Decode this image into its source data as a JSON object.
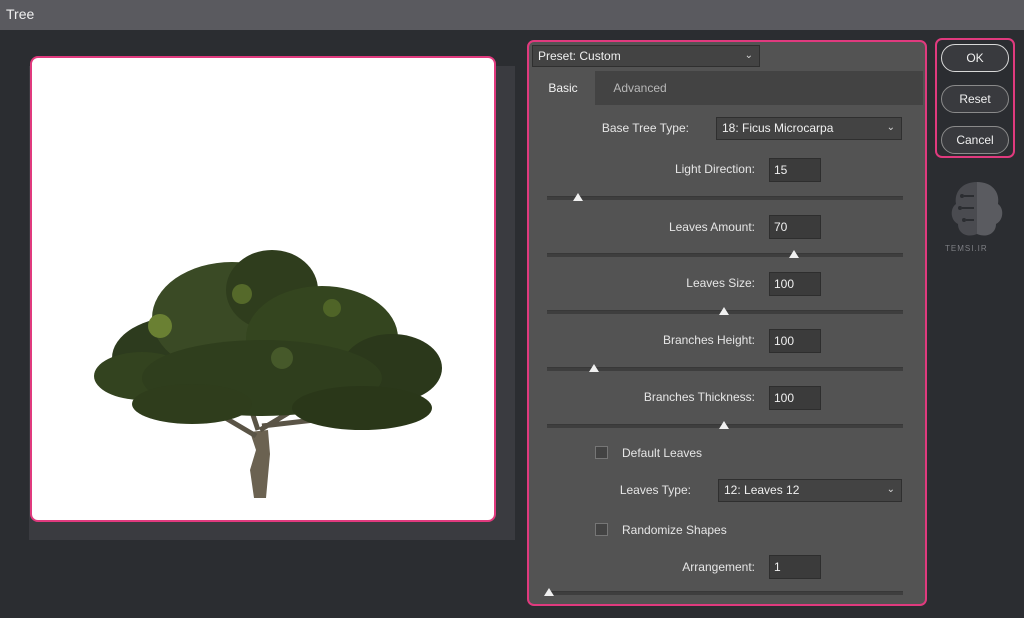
{
  "window": {
    "title": "Tree"
  },
  "preset": {
    "label": "Preset: Custom"
  },
  "tabs": [
    {
      "label": "Basic",
      "active": true
    },
    {
      "label": "Advanced",
      "active": false
    }
  ],
  "basic": {
    "base_tree_type": {
      "label": "Base Tree Type:",
      "value": "18: Ficus Microcarpa"
    },
    "light_direction": {
      "label": "Light Direction:",
      "value": "15"
    },
    "leaves_amount": {
      "label": "Leaves Amount:",
      "value": "70"
    },
    "leaves_size": {
      "label": "Leaves Size:",
      "value": "100"
    },
    "branches_height": {
      "label": "Branches Height:",
      "value": "100"
    },
    "branches_thickness": {
      "label": "Branches Thickness:",
      "value": "100"
    },
    "default_leaves": {
      "label": "Default Leaves",
      "checked": false
    },
    "leaves_type": {
      "label": "Leaves Type:",
      "value": "12: Leaves 12"
    },
    "randomize_shapes": {
      "label": "Randomize Shapes",
      "checked": false
    },
    "arrangement": {
      "label": "Arrangement:",
      "value": "1"
    }
  },
  "buttons": {
    "ok": "OK",
    "reset": "Reset",
    "cancel": "Cancel"
  },
  "watermark": {
    "text": "TEMSI.IR"
  },
  "colors": {
    "accent": "#e03a7e",
    "panel": "#535353",
    "background": "#2b2d31"
  }
}
